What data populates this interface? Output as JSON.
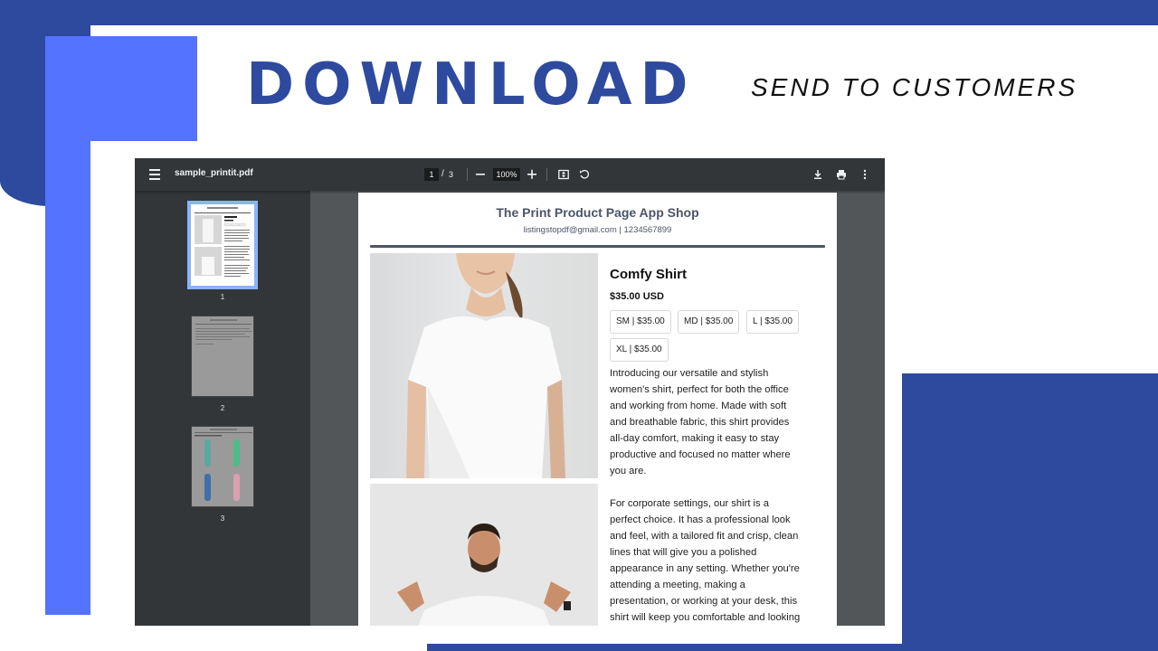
{
  "banner": {
    "headline": "DOWNLOAD",
    "subheadline": "SEND TO CUSTOMERS"
  },
  "colors": {
    "brand_dark": "#2d4a9e",
    "brand_bright": "#5473ff",
    "viewer_toolbar": "#323639",
    "viewer_bg": "#525659"
  },
  "viewer": {
    "filename": "sample_printit.pdf",
    "current_page": "1",
    "page_separator": "/",
    "total_pages": "3",
    "zoom": "100%",
    "icons": [
      "menu-icon",
      "zoom-out-icon",
      "zoom-in-icon",
      "fit-page-icon",
      "rotate-icon",
      "download-icon",
      "print-icon",
      "more-options-icon"
    ],
    "thumbnails": [
      {
        "label": "1",
        "active": true
      },
      {
        "label": "2",
        "active": false
      },
      {
        "label": "3",
        "active": false
      }
    ]
  },
  "document": {
    "shop_title": "The Print Product Page App Shop",
    "contact": "listingstopdf@gmail.com | 1234567899",
    "product_name": "Comfy Shirt",
    "price": "$35.00 USD",
    "variants": [
      "SM | $35.00",
      "MD | $35.00",
      "L | $35.00",
      "XL | $35.00"
    ],
    "description_lines": [
      "Introducing our versatile and stylish",
      "women's shirt, perfect for both the office",
      "and working from home. Made with soft",
      "and breathable fabric, this shirt provides",
      "all-day comfort, making it easy to stay",
      "productive and focused no matter where",
      "you are.",
      "",
      "For corporate settings, our shirt is a",
      "perfect choice. It has a professional look",
      "and feel, with a tailored fit and crisp, clean",
      "lines that will give you a polished",
      "appearance in any setting. Whether you're",
      "attending a meeting, making a",
      "presentation, or working at your desk, this",
      "shirt will keep you comfortable and looking"
    ]
  }
}
